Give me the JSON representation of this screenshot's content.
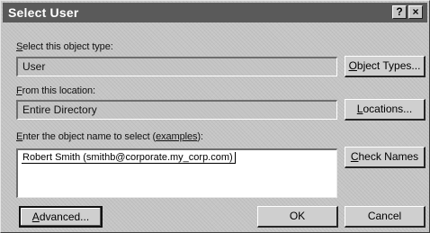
{
  "dialog": {
    "title": "Select User",
    "help_label": "?",
    "close_label": "×"
  },
  "object_type": {
    "label_prefix": "",
    "label_accel": "S",
    "label_rest": "elect this object type:",
    "value": "User",
    "button_accel": "O",
    "button_rest": "bject Types..."
  },
  "location": {
    "label_accel": "F",
    "label_rest": "rom this location:",
    "value": "Entire Directory",
    "button_accel": "L",
    "button_rest": "ocations..."
  },
  "object_name": {
    "label_accel": "E",
    "label_rest1": "nter the object name to select (",
    "label_link": "examples",
    "label_rest2": "):",
    "value": "Robert Smith (smithb@corporate.my_corp.com)",
    "check_accel": "C",
    "check_rest": "heck Names"
  },
  "footer": {
    "advanced_accel": "A",
    "advanced_rest": "dvanced...",
    "ok_label": "OK",
    "cancel_label": "Cancel"
  }
}
